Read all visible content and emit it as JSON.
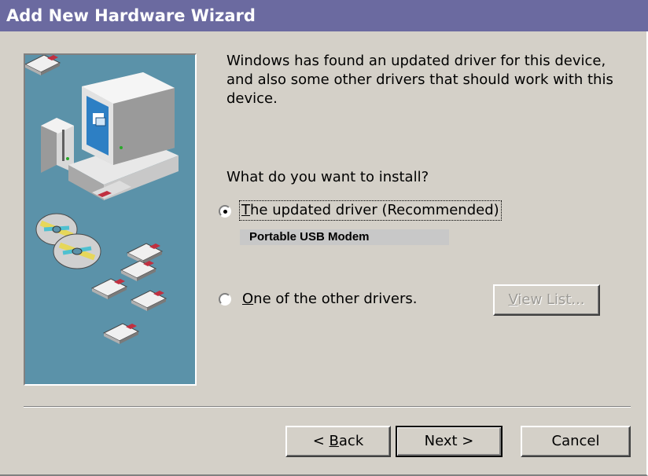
{
  "window": {
    "title": "Add New Hardware Wizard"
  },
  "content": {
    "intro": "Windows has found an updated driver for this device, and also some other drivers that should work with this device.",
    "question": "What do you want to install?",
    "option_updated": {
      "label_prefix": "",
      "accel": "T",
      "label_rest": "he updated driver (Recommended)",
      "selected": true
    },
    "device_name": "Portable USB Modem",
    "option_other": {
      "accel": "O",
      "label_rest": "ne of the other drivers.",
      "selected": false
    },
    "view_list": {
      "accel": "V",
      "label_rest": "iew List..."
    }
  },
  "buttons": {
    "back_prefix": "< ",
    "back_accel": "B",
    "back_rest": "ack",
    "next": "Next >",
    "cancel": "Cancel"
  },
  "colors": {
    "titlebar": "#6b6aa0",
    "face": "#d4d0c8",
    "illustration_bg": "#5b92a9"
  }
}
